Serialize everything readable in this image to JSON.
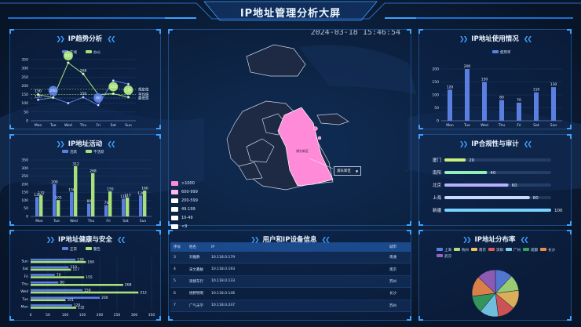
{
  "header": {
    "title": "IP地址管理分析大屏"
  },
  "datetime": "2024-03-18 15:46:54",
  "panels": {
    "trend": {
      "title": "IP趋势分析"
    },
    "activity": {
      "title": "IP地址活动"
    },
    "health": {
      "title": "IP地址健康与安全"
    },
    "usage": {
      "title": "IP地址使用情况"
    },
    "compliance": {
      "title": "IP合规性与审计"
    },
    "distribution": {
      "title": "IP地址分布率"
    },
    "users": {
      "title": "用户和IP设备信息"
    }
  },
  "map": {
    "legend": [
      {
        "label": ">1000",
        "color": "#ff8ad8"
      },
      {
        "label": "600-999",
        "color": "#ffb8e8"
      },
      {
        "label": "200-599",
        "color": "#ffffff"
      },
      {
        "label": "49-199",
        "color": "#ffffff"
      },
      {
        "label": "10-49",
        "color": "#ffffff"
      },
      {
        "label": "<9",
        "color": "#ffffff"
      }
    ],
    "highlight_label": "浦东新区",
    "tooltip": "浦东新区"
  },
  "table": {
    "headers": [
      "序号",
      "姓名",
      "IP",
      "城市"
    ],
    "rows": [
      [
        "3",
        "刘雅静",
        "10.118.0.179",
        "南通"
      ],
      [
        "4",
        "宋文鑫敏",
        "10.118.0.193",
        "南京"
      ],
      [
        "5",
        "梁建车行",
        "10.118.0.133",
        "苏州"
      ],
      [
        "6",
        "杨野明明",
        "10.118.0.146",
        "长沙"
      ],
      [
        "7",
        "广气天学",
        "10.118.0.247",
        "苏州"
      ]
    ]
  },
  "chart_data": [
    {
      "id": "trend",
      "type": "line",
      "categories": [
        "Mon",
        "Tue",
        "Wed",
        "Thu",
        "Fri",
        "Sat",
        "Sun"
      ],
      "ylim": [
        0,
        350
      ],
      "yticks": [
        0,
        50,
        100,
        150,
        200,
        250,
        300,
        350
      ],
      "legend": "top",
      "series": [
        {
          "name": "在线",
          "color": "#5a7fe0",
          "values": [
            120,
            132,
            101,
            134,
            90,
            230,
            210
          ],
          "labels": [
            "120",
            "132",
            "101",
            "134",
            "90",
            "230",
            "210"
          ]
        },
        {
          "name": "办公",
          "color": "#a8e07a",
          "values": [
            150,
            132,
            332,
            268,
            150,
            155,
            135
          ],
          "labels": [
            "150",
            "132",
            "332",
            "268",
            "150",
            "155",
            "135"
          ]
        }
      ],
      "bubbles": [
        {
          "series": 0,
          "index": 1,
          "text": "200"
        },
        {
          "series": 0,
          "index": 4,
          "text": "90"
        },
        {
          "series": 1,
          "index": 2,
          "text": "332"
        },
        {
          "series": 1,
          "index": 5,
          "text": "155"
        },
        {
          "series": 1,
          "index": 6,
          "text": "135"
        }
      ],
      "end_labels": [
        "规定值",
        "平均值",
        "最低值"
      ],
      "point_labels": [
        {
          "series": 0,
          "index": 0,
          "text": "120"
        },
        {
          "series": 0,
          "index": 1,
          "text": "132"
        },
        {
          "series": 0,
          "index": 3,
          "text": "150"
        },
        {
          "series": 1,
          "index": 0,
          "text": "150"
        },
        {
          "series": 1,
          "index": 3,
          "text": "268"
        }
      ]
    },
    {
      "id": "activity",
      "type": "bar",
      "categories": [
        "Mon",
        "Tue",
        "Wed",
        "Thu",
        "Fri",
        "Sat",
        "Sun"
      ],
      "ylim": [
        0,
        350
      ],
      "yticks": [
        0,
        50,
        100,
        150,
        200,
        250,
        300,
        350
      ],
      "legend": "top",
      "series": [
        {
          "name": "活跃",
          "color": "#5a7fe0",
          "values": [
            120,
            200,
            150,
            80,
            70,
            110,
            130
          ]
        },
        {
          "name": "不活跃",
          "color": "#a8e07a",
          "values": [
            132,
            101,
            312,
            268,
            155,
            117,
            160
          ]
        }
      ],
      "value_labels": [
        [
          "120",
          "200",
          "150",
          "80",
          "70",
          "110",
          "130"
        ],
        [
          "132",
          "101",
          "312",
          "268",
          "155",
          "117",
          "160"
        ]
      ]
    },
    {
      "id": "health",
      "type": "bar",
      "orientation": "horizontal",
      "categories": [
        "Mon",
        "Tue",
        "Wed",
        "Thu",
        "Fri",
        "Sat",
        "Sun"
      ],
      "xlim": [
        0,
        350
      ],
      "xticks": [
        0,
        50,
        100,
        150,
        200,
        250,
        300,
        350
      ],
      "legend": "top",
      "series": [
        {
          "name": "正常",
          "color": "#5a7fe0",
          "values": [
            120,
            200,
            150,
            80,
            70,
            110,
            130
          ]
        },
        {
          "name": "警告",
          "color": "#a8e07a",
          "values": [
            132,
            101,
            312,
            268,
            155,
            117,
            160
          ]
        }
      ],
      "value_labels": [
        [
          "120",
          "200",
          "150",
          "80",
          "70",
          "110",
          "130"
        ],
        [
          "132",
          "101",
          "312",
          "268",
          "155",
          "117",
          "160"
        ]
      ]
    },
    {
      "id": "usage",
      "type": "bar",
      "categories": [
        "Mon",
        "Tue",
        "Wed",
        "Thu",
        "Fri",
        "Sat",
        "Sun"
      ],
      "ylim": [
        0,
        200
      ],
      "yticks": [
        0,
        50,
        100,
        150,
        200
      ],
      "legend": "top",
      "series": [
        {
          "name": "使用率",
          "color": "#5a7fe0",
          "values": [
            120,
            200,
            150,
            80,
            70,
            110,
            130
          ]
        }
      ],
      "value_labels": [
        [
          "120",
          "200",
          "150",
          "80",
          "70",
          "110",
          "130"
        ]
      ]
    },
    {
      "id": "compliance",
      "type": "bar",
      "orientation": "horizontal",
      "categories": [
        "厦门",
        "南阳",
        "北京",
        "上海",
        "新疆"
      ],
      "xlim": [
        0,
        100
      ],
      "series": [
        {
          "name": "合规性",
          "values": [
            20,
            40,
            60,
            80,
            100
          ],
          "colors": [
            "#c9f07a",
            "#8ff0b8",
            "#b8b0ff",
            "#c8d8ff",
            "#7ad0ff"
          ]
        }
      ],
      "value_labels": [
        [
          "20",
          "40",
          "60",
          "80",
          "100"
        ]
      ]
    },
    {
      "id": "distribution",
      "type": "pie",
      "legend": "top",
      "slices": [
        {
          "name": "上海",
          "value": 12,
          "color": "#5a7fe0"
        },
        {
          "name": "杭州",
          "value": 11,
          "color": "#a8e07a"
        },
        {
          "name": "南京",
          "value": 13,
          "color": "#f0c060"
        },
        {
          "name": "深圳",
          "value": 12,
          "color": "#e05a5a"
        },
        {
          "name": "广州",
          "value": 13,
          "color": "#7ad0f0"
        },
        {
          "name": "成都",
          "value": 12,
          "color": "#3aa060"
        },
        {
          "name": "长沙",
          "value": 14,
          "color": "#f08a4a"
        },
        {
          "name": "武汉",
          "value": 13,
          "color": "#9a60c0"
        }
      ]
    }
  ]
}
